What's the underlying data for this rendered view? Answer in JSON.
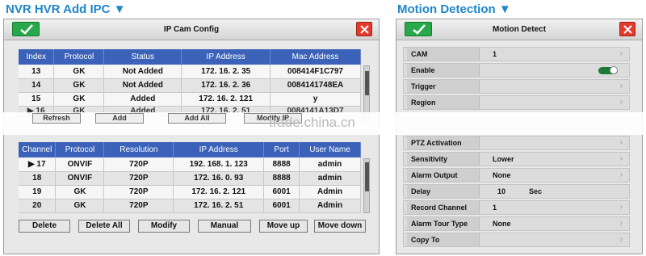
{
  "titles": {
    "left": "NVR HVR Add IPC ▼",
    "right": "Motion Detection ▼"
  },
  "ipcam": {
    "title": "IP Cam Config",
    "added_columns": [
      "Index",
      "Protocol",
      "Status",
      "IP Address",
      "Mac Address"
    ],
    "added_rows": [
      [
        "13",
        "GK",
        "Not Added",
        "172. 16. 2. 35",
        "008414F1C797"
      ],
      [
        "14",
        "GK",
        "Not Added",
        "172. 16. 2. 36",
        "0084141748EA"
      ],
      [
        "15",
        "GK",
        "Added",
        "172. 16. 2. 121",
        "y"
      ]
    ],
    "partial_row": [
      "▶ 16",
      "GK",
      "Added",
      "172. 16. 2. 51",
      "0084141A13D7"
    ],
    "ghost_buttons": [
      "Refresh",
      "Add",
      "Add All",
      "Modify IP"
    ],
    "found_columns": [
      "Channel",
      "Protocol",
      "Resolution",
      "IP Address",
      "Port",
      "User Name"
    ],
    "found_rows": [
      [
        "▶ 17",
        "ONVIF",
        "720P",
        "192. 168. 1. 123",
        "8888",
        "admin"
      ],
      [
        "18",
        "ONVIF",
        "720P",
        "172. 16. 0. 93",
        "8888",
        "admin"
      ],
      [
        "19",
        "GK",
        "720P",
        "172. 16. 2. 121",
        "6001",
        "Admin"
      ],
      [
        "20",
        "GK",
        "720P",
        "172. 16. 2. 51",
        "6001",
        "Admin"
      ]
    ],
    "buttons": {
      "delete": "Delete",
      "delete_all": "Delete All",
      "modify": "Modify",
      "manual": "Manual",
      "move_up": "Move up",
      "move_down": "Move down"
    }
  },
  "motion": {
    "title": "Motion Detect",
    "cam": {
      "label": "CAM",
      "value": "1"
    },
    "enable": {
      "label": "Enable",
      "on": true
    },
    "trigger": {
      "label": "Trigger"
    },
    "region": {
      "label": "Region"
    },
    "ptz": {
      "label": "PTZ Activation"
    },
    "sensitivity": {
      "label": "Sensitivity",
      "value": "Lower"
    },
    "alarm_output": {
      "label": "Alarm Output",
      "value": "None"
    },
    "delay": {
      "label": "Delay",
      "value": "10",
      "unit": "Sec"
    },
    "record_channel": {
      "label": "Record Channel",
      "value": "1"
    },
    "alarm_tour": {
      "label": "Alarm Tour Type",
      "value": "None"
    },
    "copy_to": {
      "label": "Copy To"
    }
  },
  "watermark": "trade.china.cn",
  "colors": {
    "title_blue": "#1f86c8",
    "table_header": "#3b62b8",
    "ok_green": "#27a84a",
    "close_red": "#e23b2c",
    "toggle_on": "#1e7a36"
  },
  "icons": {
    "ok": "checkmark-icon",
    "close": "close-icon",
    "chevron": "chevron-right-icon",
    "row_selector": "triangle-right-icon"
  }
}
